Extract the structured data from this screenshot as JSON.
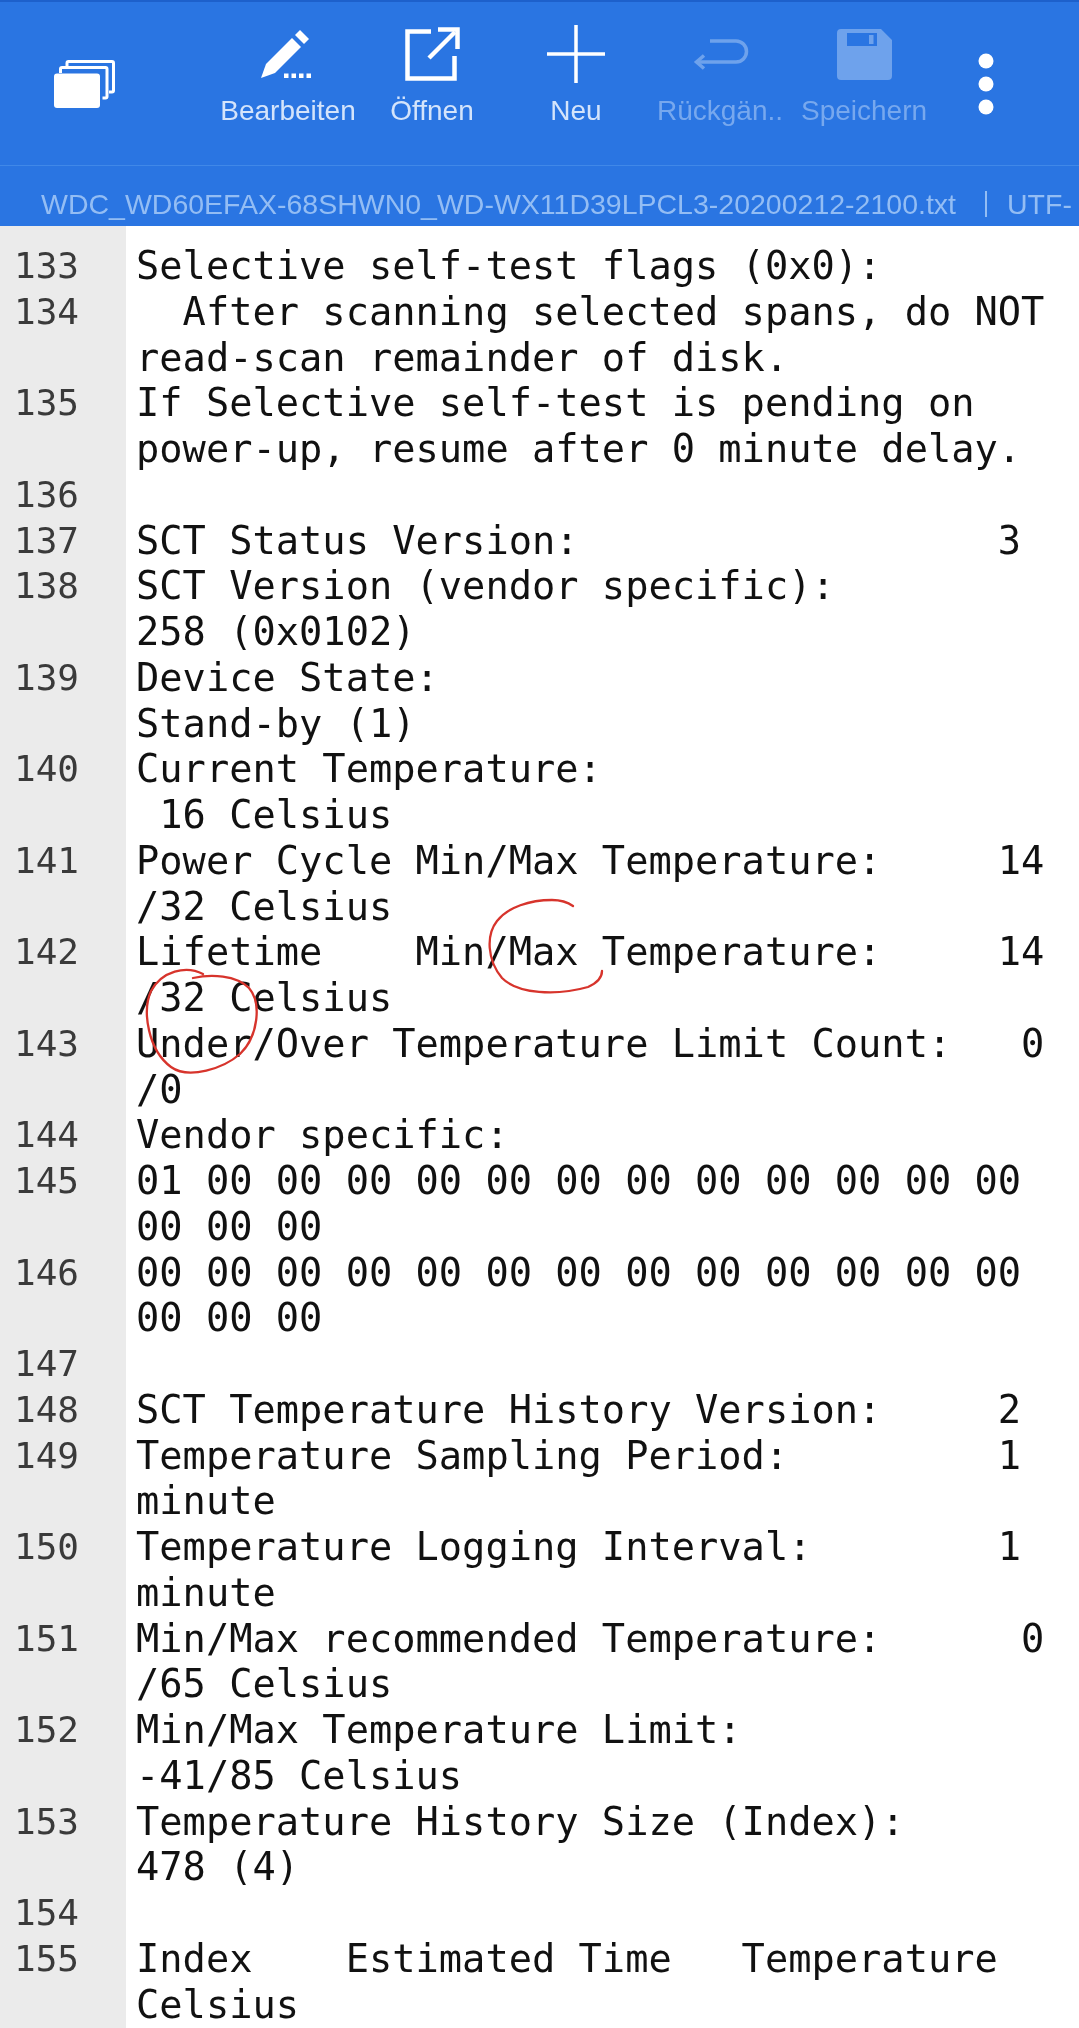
{
  "toolbar": {
    "items": [
      {
        "kind": "documents",
        "disabled": false
      },
      {
        "kind": "edit",
        "label": "Bearbeiten",
        "disabled": false
      },
      {
        "kind": "open",
        "label": "Öffnen",
        "disabled": false
      },
      {
        "kind": "new",
        "label": "Neu",
        "disabled": false
      },
      {
        "kind": "undo",
        "label": "Rückgän..",
        "disabled": true
      },
      {
        "kind": "save",
        "label": "Speichern",
        "disabled": true
      },
      {
        "kind": "more",
        "disabled": false
      }
    ]
  },
  "file_bar": {
    "filename": "WDC_WD60EFAX-68SHWN0_WD-WX11D39LPCL3-20200212-2100.txt",
    "encoding": "UTF-"
  },
  "editor": {
    "lines": [
      {
        "number": "133",
        "rows": [
          "Selective self-test flags (0x0):"
        ]
      },
      {
        "number": "134",
        "rows": [
          "  After scanning selected spans, do NOT",
          "read-scan remainder of disk."
        ]
      },
      {
        "number": "135",
        "rows": [
          "If Selective self-test is pending on",
          "power-up, resume after 0 minute delay."
        ]
      },
      {
        "number": "136"
      },
      {
        "number": "137",
        "rows": [
          "SCT Status Version:                  3"
        ]
      },
      {
        "number": "138",
        "rows": [
          "SCT Version (vendor specific):",
          "258 (0x0102)"
        ]
      },
      {
        "number": "139",
        "rows": [
          "Device State:",
          "Stand-by (1)"
        ]
      },
      {
        "number": "140",
        "rows": [
          "Current Temperature:",
          " 16 Celsius"
        ]
      },
      {
        "number": "141",
        "rows": [
          "Power Cycle Min/Max Temperature:     14",
          "/32 Celsius"
        ]
      },
      {
        "number": "142",
        "rows": [
          "Lifetime    Min/Max Temperature:     14",
          "/32 Celsius"
        ]
      },
      {
        "number": "143",
        "rows": [
          "Under/Over Temperature Limit Count:   0",
          "/0"
        ]
      },
      {
        "number": "144",
        "rows": [
          "Vendor specific:"
        ]
      },
      {
        "number": "145",
        "rows": [
          "01 00 00 00 00 00 00 00 00 00 00 00 00",
          "00 00 00"
        ]
      },
      {
        "number": "146",
        "rows": [
          "00 00 00 00 00 00 00 00 00 00 00 00 00",
          "00 00 00"
        ]
      },
      {
        "number": "147"
      },
      {
        "number": "148",
        "rows": [
          "SCT Temperature History Version:     2"
        ]
      },
      {
        "number": "149",
        "rows": [
          "Temperature Sampling Period:         1",
          "minute"
        ]
      },
      {
        "number": "150",
        "rows": [
          "Temperature Logging Interval:        1",
          "minute"
        ]
      },
      {
        "number": "151",
        "rows": [
          "Min/Max recommended Temperature:      0",
          "/65 Celsius"
        ]
      },
      {
        "number": "152",
        "rows": [
          "Min/Max Temperature Limit:",
          "-41/85 Celsius"
        ]
      },
      {
        "number": "153",
        "rows": [
          "Temperature History Size (Index):",
          "478 (4)"
        ]
      },
      {
        "number": "154"
      },
      {
        "number": "155",
        "rows": [
          "Index    Estimated Time   Temperature",
          "Celsius"
        ]
      }
    ]
  },
  "annotations": [
    {
      "kind": "circle"
    },
    {
      "kind": "circle"
    }
  ]
}
